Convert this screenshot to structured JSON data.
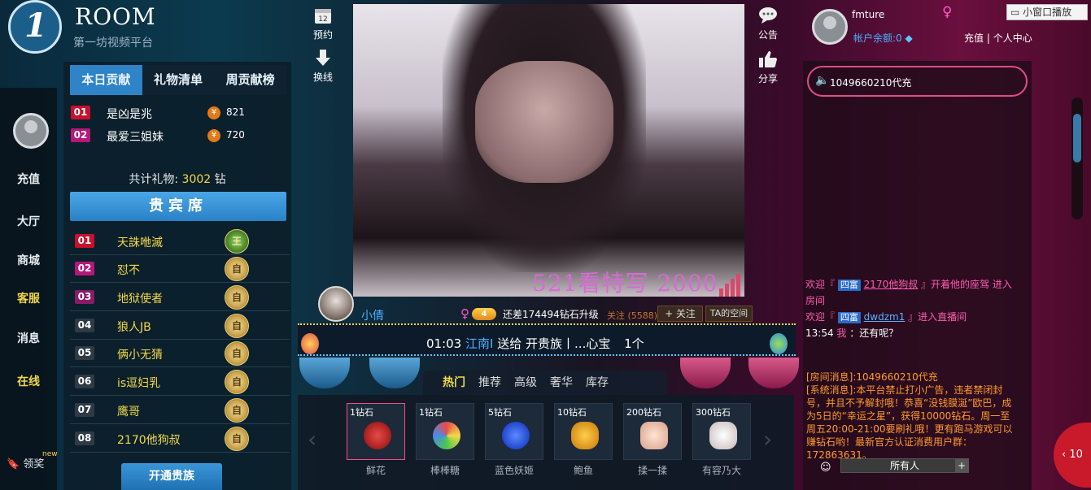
{
  "brand": {
    "room": "ROOM",
    "subtitle": "第一坊视频平台"
  },
  "left_nav": {
    "items": [
      {
        "label": "充值",
        "highlight": false
      },
      {
        "label": "大厅",
        "highlight": false
      },
      {
        "label": "商城",
        "highlight": false
      },
      {
        "label": "客服",
        "highlight": true
      },
      {
        "label": "消息",
        "highlight": false
      },
      {
        "label": "在线",
        "highlight": true
      }
    ],
    "reward_label": "领奖",
    "new_label": "new"
  },
  "contribution": {
    "tabs": [
      "本日贡献",
      "礼物清单",
      "周贡献榜"
    ],
    "active_tab": 0,
    "ranks": [
      {
        "rank": "01",
        "name": "是凶是兆",
        "value": "821"
      },
      {
        "rank": "02",
        "name": "最爱三姐妹",
        "value": "720"
      }
    ],
    "total_label": "共计礼物:",
    "total_value": "3002",
    "total_unit": "钻"
  },
  "vip": {
    "header": "贵宾席",
    "rows": [
      {
        "rank": "01",
        "name": "天誅咃滅"
      },
      {
        "rank": "02",
        "name": "怼不"
      },
      {
        "rank": "03",
        "name": "地狱使者"
      },
      {
        "rank": "04",
        "name": "狼人JB"
      },
      {
        "rank": "05",
        "name": "俩小无猜"
      },
      {
        "rank": "06",
        "name": "is逗妇乳"
      },
      {
        "rank": "07",
        "name": "鹰哥"
      },
      {
        "rank": "08",
        "name": "2170他狗叔"
      }
    ],
    "open_button": "开通贵族"
  },
  "tools": {
    "reserve": "预约",
    "switch": "换线",
    "notice": "公告",
    "share": "分享"
  },
  "video": {
    "caption": "521看特写 2000"
  },
  "anchor": {
    "name": "小倩",
    "level": "4",
    "upgrade_text": "还差174494钻石升级",
    "fans": "关注 (5588)",
    "follow_btn": "+ 关注",
    "space_btn": "TA的空间"
  },
  "marquee": {
    "time": "01:03",
    "from": "江南I",
    "action": "送给",
    "to": "开贵族丨...心宝",
    "count": "1个"
  },
  "gift_tabs": [
    "热门",
    "推荐",
    "高级",
    "奢华",
    "库存"
  ],
  "gifts": [
    {
      "price": "1钻石",
      "name": "鲜花",
      "color": "#c81a1a"
    },
    {
      "price": "1钻石",
      "name": "棒棒糖",
      "color": "#e88a2a"
    },
    {
      "price": "5钻石",
      "name": "蓝色妖姬",
      "color": "#1a4ad8"
    },
    {
      "price": "10钻石",
      "name": "鲍鱼",
      "color": "#e8a21a"
    },
    {
      "price": "200钻石",
      "name": "揉一揉",
      "color": "#f2c8b0"
    },
    {
      "price": "300钻石",
      "name": "有容乃大",
      "color": "#e8e0e0"
    }
  ],
  "user": {
    "name": "fmture",
    "balance": "帐户余额:0",
    "recharge": "充值",
    "center": "个人中心",
    "mini_window": "小窗口播放"
  },
  "chat": {
    "speaker": "1049660210代充",
    "lines": [
      {
        "prefix": "欢迎『",
        "tag": "四富",
        "user": "2170他狗叔",
        "suffix": "』开着他的座驾",
        "tail": "进入房间"
      },
      {
        "prefix": "欢迎『",
        "tag": "四富",
        "user": "dwdzm1",
        "suffix": "』进入直播间",
        "tail": ""
      },
      {
        "prefix": "13:54",
        "tag": "",
        "user": "我",
        "suffix": "：还有呢？",
        "tail": ""
      }
    ],
    "room_msg": "[房间消息]:1049660210代充",
    "system_msg": "[系统消息]:本平台禁止打小广告，违者禁闭封号，并且不予解封哦！恭喜“没钱膜涎”欧巴，成为5日的“幸运之星”，获得10000钻石。周一至周五20:00-21:00要刷礼哦！更有跑马游戏可以赚钻石哟！最新官方认证消费用户群：172863631。",
    "target": "所有人",
    "side_count": "10"
  },
  "colors": {
    "accent_blue": "#2f83c7",
    "gold": "#f3d84a",
    "pink": "#ff5ab0",
    "rank1": "#c8102e"
  }
}
